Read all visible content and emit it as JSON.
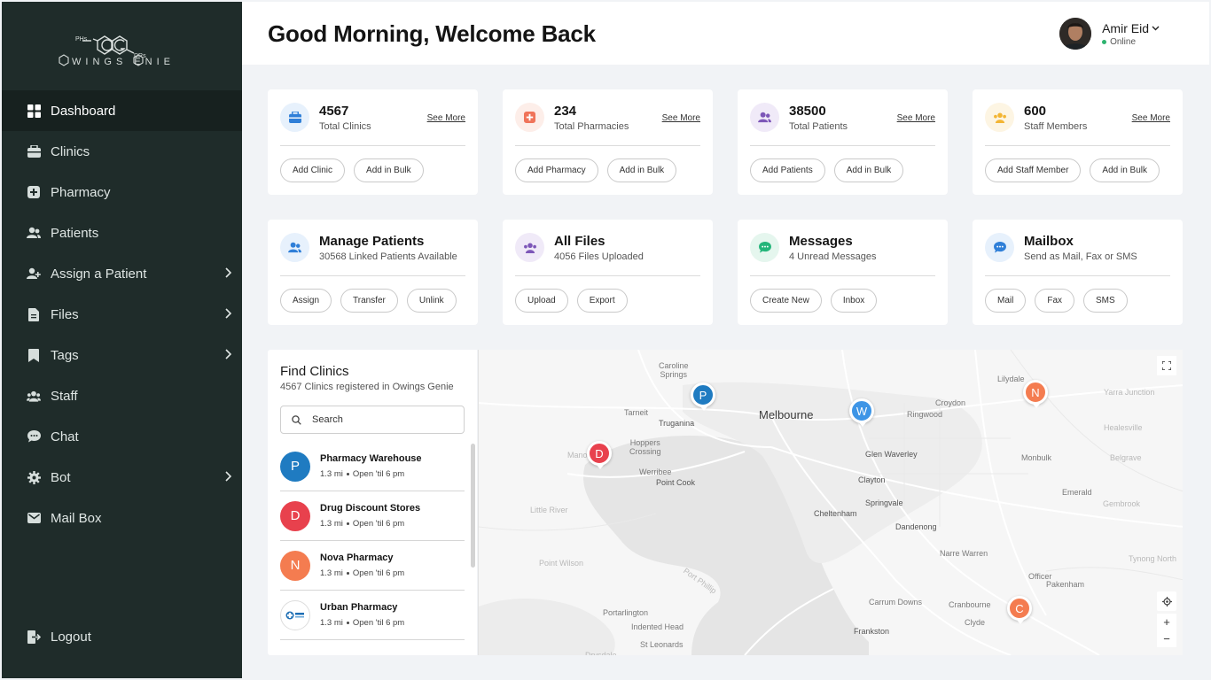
{
  "app": {
    "logo_superscript_left": "PHs",
    "logo_superscript_right": "DRs",
    "logo_text": "WINGS ENIE"
  },
  "sidebar": {
    "items": [
      {
        "label": "Dashboard",
        "icon": "grid-icon",
        "active": true,
        "has_submenu": false
      },
      {
        "label": "Clinics",
        "icon": "clinic-icon",
        "active": false,
        "has_submenu": false
      },
      {
        "label": "Pharmacy",
        "icon": "pharmacy-icon",
        "active": false,
        "has_submenu": false
      },
      {
        "label": "Patients",
        "icon": "patients-icon",
        "active": false,
        "has_submenu": false
      },
      {
        "label": "Assign a Patient",
        "icon": "assign-patient-icon",
        "active": false,
        "has_submenu": true
      },
      {
        "label": "Files",
        "icon": "file-icon",
        "active": false,
        "has_submenu": true
      },
      {
        "label": "Tags",
        "icon": "tag-icon",
        "active": false,
        "has_submenu": true
      },
      {
        "label": "Staff",
        "icon": "staff-icon",
        "active": false,
        "has_submenu": false
      },
      {
        "label": "Chat",
        "icon": "chat-icon",
        "active": false,
        "has_submenu": false
      },
      {
        "label": "Bot",
        "icon": "gear-icon",
        "active": false,
        "has_submenu": true
      },
      {
        "label": "Mail Box",
        "icon": "mail-icon",
        "active": false,
        "has_submenu": false
      }
    ],
    "logout_label": "Logout"
  },
  "header": {
    "greeting": "Good Morning, Welcome Back",
    "user_name": "Amir Eid",
    "user_status": "Online"
  },
  "stats": [
    {
      "value": "4567",
      "label": "Total Clinics",
      "see_more": "See More",
      "buttons": [
        "Add Clinic",
        "Add in Bulk"
      ],
      "icon": "clinic-icon",
      "color": "#2f7fd8",
      "bg": "#e7f1fc"
    },
    {
      "value": "234",
      "label": "Total Pharmacies",
      "see_more": "See More",
      "buttons": [
        "Add Pharmacy",
        "Add in Bulk"
      ],
      "icon": "pharmacy-icon",
      "color": "#f0745a",
      "bg": "#fdeee9"
    },
    {
      "value": "38500",
      "label": "Total Patients",
      "see_more": "See More",
      "buttons": [
        "Add Patients",
        "Add in Bulk"
      ],
      "icon": "patients-icon",
      "color": "#7d57b8",
      "bg": "#f0eaf8"
    },
    {
      "value": "600",
      "label": "Staff Members",
      "see_more": "See More",
      "buttons": [
        "Add Staff Member",
        "Add in Bulk"
      ],
      "icon": "staff-icon",
      "color": "#f3b533",
      "bg": "#fdf5e3"
    }
  ],
  "actions": [
    {
      "title": "Manage Patients",
      "subtitle": "30568 Linked Patients Available",
      "buttons": [
        "Assign",
        "Transfer",
        "Unlink"
      ],
      "icon": "patients-icon",
      "color": "#2f7fd8",
      "bg": "#e7f1fc"
    },
    {
      "title": "All Files",
      "subtitle": "4056 Files Uploaded",
      "buttons": [
        "Upload",
        "Export"
      ],
      "icon": "files-icon",
      "color": "#7d57b8",
      "bg": "#f0eaf8"
    },
    {
      "title": "Messages",
      "subtitle": "4 Unread Messages",
      "buttons": [
        "Create New",
        "Inbox"
      ],
      "icon": "chat-icon",
      "color": "#24b57a",
      "bg": "#e5f6ee"
    },
    {
      "title": "Mailbox",
      "subtitle": "Send as Mail, Fax or SMS",
      "buttons": [
        "Mail",
        "Fax",
        "SMS"
      ],
      "icon": "chat-icon",
      "color": "#2f7fd8",
      "bg": "#e7f1fc"
    }
  ],
  "finder": {
    "title": "Find Clinics",
    "subtitle": "4567 Clinics registered in Owings Genie",
    "search_placeholder": "Search",
    "clinics": [
      {
        "initial": "P",
        "name": "Pharmacy Warehouse",
        "distance": "1.3 mi",
        "hours": "Open 'til 6 pm",
        "color": "#1f7bc1"
      },
      {
        "initial": "D",
        "name": "Drug Discount Stores",
        "distance": "1.3 mi",
        "hours": "Open 'til 6 pm",
        "color": "#e8414d"
      },
      {
        "initial": "N",
        "name": "Nova Pharmacy",
        "distance": "1.3 mi",
        "hours": "Open 'til 6 pm",
        "color": "#f47c50"
      },
      {
        "initial": "",
        "name": "Urban Pharmacy",
        "distance": "1.3 mi",
        "hours": "Open 'til 6 pm",
        "color": "#ffffff"
      }
    ]
  },
  "map": {
    "labels": [
      {
        "text": "Caroline\nSprings",
        "cls": ""
      },
      {
        "text": "Tarneit",
        "cls": ""
      },
      {
        "text": "Truganina",
        "cls": "dark"
      },
      {
        "text": "Melbourne",
        "cls": "big"
      },
      {
        "text": "Ringwood",
        "cls": ""
      },
      {
        "text": "Croydon",
        "cls": ""
      },
      {
        "text": "Lilydale",
        "cls": ""
      },
      {
        "text": "Yarra Junction",
        "cls": "light"
      },
      {
        "text": "Healesville",
        "cls": "light"
      },
      {
        "text": "Hoppers\nCrossing",
        "cls": ""
      },
      {
        "text": "Werribee",
        "cls": ""
      },
      {
        "text": "Point Cook",
        "cls": "dark"
      },
      {
        "text": "Glen Waverley",
        "cls": "dark"
      },
      {
        "text": "Monbulk",
        "cls": ""
      },
      {
        "text": "Belgrave",
        "cls": "light"
      },
      {
        "text": "Clayton",
        "cls": "dark"
      },
      {
        "text": "Springvale",
        "cls": "dark"
      },
      {
        "text": "Emerald",
        "cls": ""
      },
      {
        "text": "Gembrook",
        "cls": "light"
      },
      {
        "text": "Little River",
        "cls": "light"
      },
      {
        "text": "Cheltenham",
        "cls": "dark"
      },
      {
        "text": "Dandenong",
        "cls": "dark"
      },
      {
        "text": "Point Wilson",
        "cls": "light"
      },
      {
        "text": "Port Phillip",
        "cls": "light"
      },
      {
        "text": "Narre Warren",
        "cls": ""
      },
      {
        "text": "Tynong North",
        "cls": "light"
      },
      {
        "text": "Officer",
        "cls": ""
      },
      {
        "text": "Pakenham",
        "cls": ""
      },
      {
        "text": "Portarlington",
        "cls": ""
      },
      {
        "text": "Carrum Downs",
        "cls": ""
      },
      {
        "text": "Cranbourne",
        "cls": ""
      },
      {
        "text": "Indented Head",
        "cls": ""
      },
      {
        "text": "Clyde",
        "cls": ""
      },
      {
        "text": "Frankston",
        "cls": "dark"
      },
      {
        "text": "St Leonards",
        "cls": ""
      },
      {
        "text": "Drysdale",
        "cls": "light"
      },
      {
        "text": "Manor",
        "cls": "light"
      }
    ],
    "markers": [
      {
        "initial": "P",
        "color": "#1f7bc1"
      },
      {
        "initial": "W",
        "color": "#3e95e6"
      },
      {
        "initial": "N",
        "color": "#f47c50"
      },
      {
        "initial": "D",
        "color": "#e8414d"
      },
      {
        "initial": "C",
        "color": "#f47c50"
      }
    ],
    "controls": [
      "fullscreen-icon",
      "locate-icon",
      "+",
      "−"
    ]
  }
}
